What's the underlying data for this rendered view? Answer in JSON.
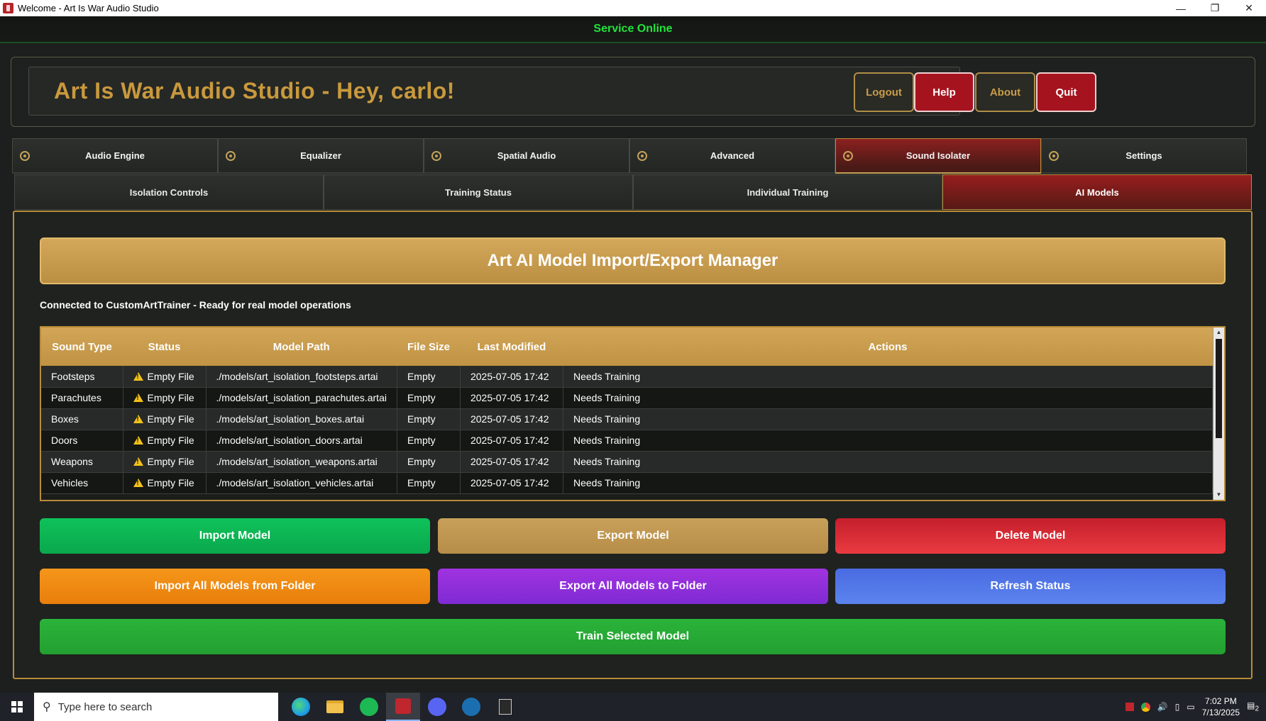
{
  "window": {
    "title": "Welcome - Art Is War Audio Studio",
    "controls": [
      "—",
      "❐",
      "✕"
    ]
  },
  "service_status": "Service Online",
  "header": {
    "title": "Art Is War Audio Studio - Hey, carlo!",
    "buttons": {
      "logout": "Logout",
      "help": "Help",
      "about": "About",
      "quit": "Quit"
    }
  },
  "main_tabs": [
    "Audio Engine",
    "Equalizer",
    "Spatial Audio",
    "Advanced",
    "Sound Isolater",
    "Settings"
  ],
  "main_tab_active": 4,
  "sub_tabs": [
    "Isolation Controls",
    "Training Status",
    "Individual Training",
    "AI Models"
  ],
  "sub_tab_active": 3,
  "manager": {
    "title": "Art AI Model Import/Export Manager",
    "connection": "Connected to CustomArtTrainer - Ready for real model operations"
  },
  "table": {
    "columns": [
      "Sound Type",
      "Status",
      "Model Path",
      "File Size",
      "Last Modified",
      "Actions"
    ],
    "rows": [
      {
        "type": "Footsteps",
        "status": "Empty File",
        "path": "./models/art_isolation_footsteps.artai",
        "size": "Empty",
        "modified": "2025-07-05 17:42",
        "action": "Needs Training"
      },
      {
        "type": "Parachutes",
        "status": "Empty File",
        "path": "./models/art_isolation_parachutes.artai",
        "size": "Empty",
        "modified": "2025-07-05 17:42",
        "action": "Needs Training"
      },
      {
        "type": "Boxes",
        "status": "Empty File",
        "path": "./models/art_isolation_boxes.artai",
        "size": "Empty",
        "modified": "2025-07-05 17:42",
        "action": "Needs Training"
      },
      {
        "type": "Doors",
        "status": "Empty File",
        "path": "./models/art_isolation_doors.artai",
        "size": "Empty",
        "modified": "2025-07-05 17:42",
        "action": "Needs Training"
      },
      {
        "type": "Weapons",
        "status": "Empty File",
        "path": "./models/art_isolation_weapons.artai",
        "size": "Empty",
        "modified": "2025-07-05 17:42",
        "action": "Needs Training"
      },
      {
        "type": "Vehicles",
        "status": "Empty File",
        "path": "./models/art_isolation_vehicles.artai",
        "size": "Empty",
        "modified": "2025-07-05 17:42",
        "action": "Needs Training"
      }
    ]
  },
  "buttons": {
    "import": "Import Model",
    "export": "Export Model",
    "delete": "Delete Model",
    "import_all": "Import All Models from Folder",
    "export_all": "Export All Models to Folder",
    "refresh": "Refresh Status",
    "train": "Train Selected Model"
  },
  "taskbar": {
    "search_placeholder": "Type here to search",
    "time": "7:02 PM",
    "date": "7/13/2025",
    "notification_count": "2",
    "icons": [
      "edge-icon",
      "file-explorer-icon",
      "spotify-icon",
      "art-is-war-icon",
      "discord-icon",
      "steam-icon",
      "epic-games-icon"
    ],
    "colors": {
      "edge": "#1fa0e3",
      "explorer": "#f2c14e",
      "spotify": "#1db954",
      "app": "#c0262d",
      "discord": "#5865f2",
      "steam": "#1b6fb0"
    }
  }
}
